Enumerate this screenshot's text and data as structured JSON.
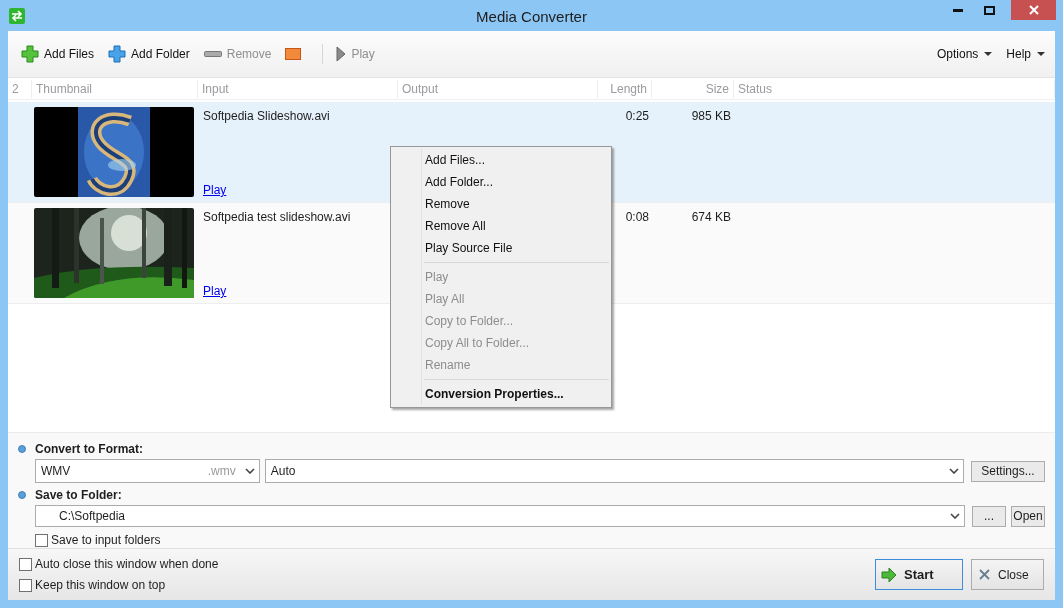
{
  "window": {
    "title": "Media Converter"
  },
  "toolbar": {
    "buttons": [
      {
        "kind": "add-files",
        "label": "Add Files",
        "disabled": false
      },
      {
        "kind": "add-folder",
        "label": "Add Folder",
        "disabled": false
      },
      {
        "kind": "remove",
        "label": "Remove",
        "disabled": true
      },
      {
        "kind": "stop"
      },
      {
        "kind": "separator"
      },
      {
        "kind": "play",
        "label": "Play",
        "disabled": true
      }
    ],
    "menus": [
      "Options",
      "Help"
    ]
  },
  "table": {
    "count": "2",
    "columns": [
      "Thumbnail",
      "Input",
      "Output",
      "Length",
      "Size",
      "Status"
    ],
    "rows": [
      {
        "input": "Softpedia Slideshow.avi",
        "length": "0:25",
        "size": "985 KB",
        "link": "Play",
        "selected": true
      },
      {
        "input": "Softpedia test slideshow.avi",
        "length": "0:08",
        "size": "674 KB",
        "link": "Play",
        "selected": false
      }
    ]
  },
  "context_menu": {
    "sections": [
      [
        {
          "label": "Add Files...",
          "disabled": false,
          "bold": false
        },
        {
          "label": "Add Folder...",
          "disabled": false,
          "bold": false
        },
        {
          "label": "Remove",
          "disabled": false,
          "bold": false
        },
        {
          "label": "Remove All",
          "disabled": false,
          "bold": false
        },
        {
          "label": "Play Source File",
          "disabled": false,
          "bold": false
        }
      ],
      [
        {
          "label": "Play",
          "disabled": true,
          "bold": false
        },
        {
          "label": "Play All",
          "disabled": true,
          "bold": false
        },
        {
          "label": "Copy to Folder...",
          "disabled": true,
          "bold": false
        },
        {
          "label": "Copy All to Folder...",
          "disabled": true,
          "bold": false
        },
        {
          "label": "Rename",
          "disabled": true,
          "bold": false
        }
      ],
      [
        {
          "label": "Conversion Properties...",
          "disabled": false,
          "bold": true
        }
      ]
    ]
  },
  "format": {
    "label": "Convert to Format:",
    "value": "WMV",
    "extension": ".wmv",
    "quality": "Auto",
    "settings_button": "Settings..."
  },
  "save": {
    "label": "Save to Folder:",
    "path": "C:\\Softpedia",
    "browse_button": "...",
    "open_button": "Open",
    "option": {
      "label": "Save to input folders",
      "checked": false
    }
  },
  "footer": {
    "options": [
      {
        "label": "Auto close this window when done",
        "checked": false
      },
      {
        "label": "Keep this window on top",
        "checked": false
      }
    ],
    "start_button": "Start",
    "close_button": "Close"
  }
}
